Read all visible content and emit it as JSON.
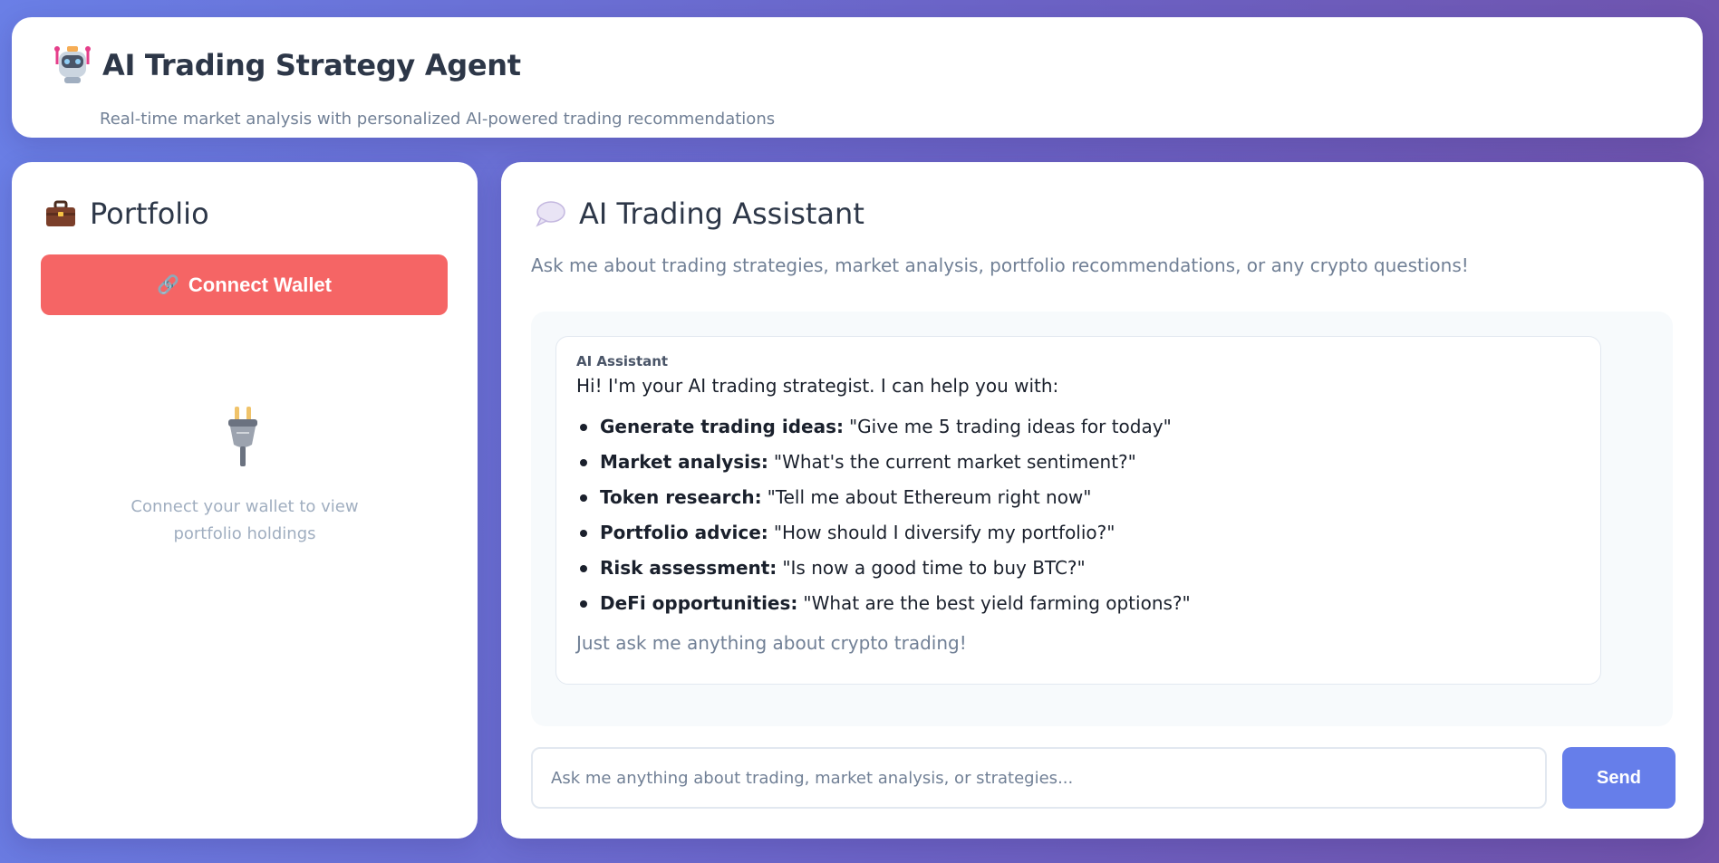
{
  "header": {
    "title": "AI Trading Strategy Agent",
    "subtitle": "Real-time market analysis with personalized AI-powered trading recommendations",
    "icon": "robot-icon"
  },
  "portfolio": {
    "title": "Portfolio",
    "icon": "briefcase-icon",
    "connect_button": {
      "label": "Connect Wallet",
      "icon": "link-icon"
    },
    "empty_state": {
      "icon": "plug-icon",
      "line1": "Connect your wallet to view",
      "line2": "portfolio holdings"
    }
  },
  "assistant": {
    "title": "AI Trading Assistant",
    "icon": "speech-bubble-icon",
    "description": "Ask me about trading strategies, market analysis, portfolio recommendations, or any crypto questions!",
    "message": {
      "sender": "AI Assistant",
      "intro": "Hi! I'm your AI trading strategist. I can help you with:",
      "items": [
        {
          "label": "Generate trading ideas:",
          "example": "\"Give me 5 trading ideas for today\""
        },
        {
          "label": "Market analysis:",
          "example": "\"What's the current market sentiment?\""
        },
        {
          "label": "Token research:",
          "example": "\"Tell me about Ethereum right now\""
        },
        {
          "label": "Portfolio advice:",
          "example": "\"How should I diversify my portfolio?\""
        },
        {
          "label": "Risk assessment:",
          "example": "\"Is now a good time to buy BTC?\""
        },
        {
          "label": "DeFi opportunities:",
          "example": "\"What are the best yield farming options?\""
        }
      ],
      "outro": "Just ask me anything about crypto trading!"
    },
    "input": {
      "value": "",
      "placeholder": "Ask me anything about trading, market analysis, or strategies..."
    },
    "send_label": "Send"
  },
  "colors": {
    "connect_button": "#f56565",
    "send_button": "#667eea",
    "background_start": "#6a7fe6",
    "background_end": "#7152aa"
  }
}
